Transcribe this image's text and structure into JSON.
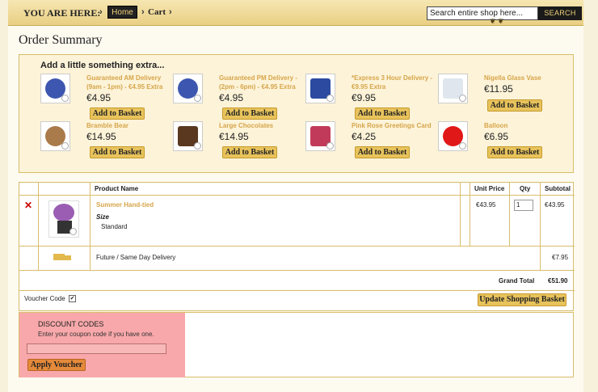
{
  "header": {
    "you_are_here": "YOU ARE HERE:",
    "home": "Home",
    "cart": "Cart",
    "search_placeholder": "Search entire shop here...",
    "search_button": "SEARCH"
  },
  "page_title": "Order Summary",
  "extras": {
    "title": "Add a little something extra...",
    "add_label": "Add to Basket",
    "items": [
      {
        "name": "Guaranteed AM Delivery (9am - 1pm) - €4.95 Extra",
        "price": "€4.95",
        "icon": "clock-icon",
        "color": "#3d57b0"
      },
      {
        "name": "Guaranteed PM Delivery - (2pm - 6pm) - €4.95 Extra",
        "price": "€4.95",
        "icon": "clock-icon",
        "color": "#3d57b0"
      },
      {
        "name": "*Express 3 Hour Delivery - €9.95 Extra",
        "price": "€9.95",
        "icon": "express-truck-icon",
        "color": "#2b4aa0"
      },
      {
        "name": "Nigella Glass Vase",
        "price": "€11.95",
        "icon": "vase-icon",
        "color": "#dfe6ee"
      },
      {
        "name": "Bramble Bear",
        "price": "€14.95",
        "icon": "teddy-bear-icon",
        "color": "#a97a4a"
      },
      {
        "name": "Large Chocolates",
        "price": "€14.95",
        "icon": "chocolates-icon",
        "color": "#5a3820"
      },
      {
        "name": "Pink Rose Greetings Card",
        "price": "€4.25",
        "icon": "card-icon",
        "color": "#c23a5a"
      },
      {
        "name": "Balloon",
        "price": "€6.95",
        "icon": "balloon-icon",
        "color": "#e01818"
      }
    ]
  },
  "basket": {
    "columns": {
      "product": "Product Name",
      "unit_price": "Unit Price",
      "qty": "Qty",
      "subtotal": "Subtotal"
    },
    "item": {
      "name": "Summer Hand-tied",
      "option_label": "Size",
      "option_value": "Standard",
      "unit_price": "€43.95",
      "qty": "1",
      "subtotal": "€43.95"
    },
    "delivery_label": "Future / Same Day Delivery",
    "delivery_price": "€7.95",
    "grand_total_label": "Grand Total",
    "grand_total": "€51.90"
  },
  "voucher": {
    "label": "Voucher Code",
    "checked": true,
    "update_button": "Update Shopping Basket"
  },
  "discount": {
    "title": "DISCOUNT CODES",
    "help": "Enter your coupon code if you have one.",
    "input_value": "",
    "apply_button": "Apply Voucher"
  },
  "colors": {
    "accent_gold": "#e8c35c",
    "link_gold": "#d6a54a",
    "discount_bg": "#f8a8aa",
    "remove_red": "#cc0000"
  }
}
